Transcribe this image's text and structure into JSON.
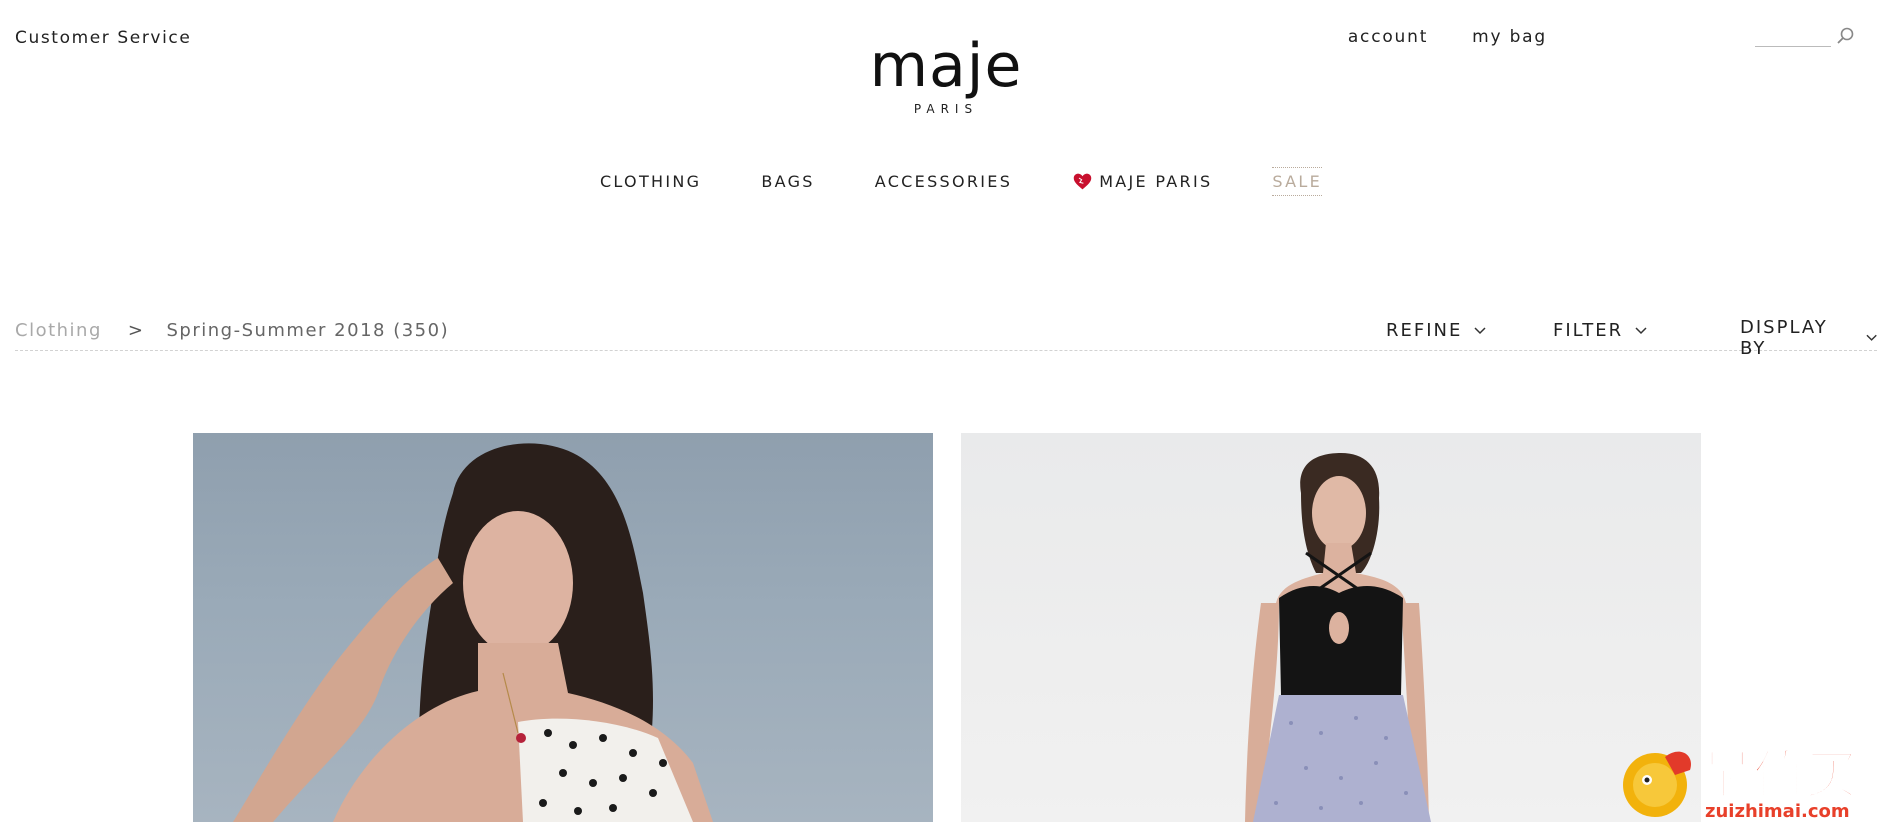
{
  "header": {
    "customer_service": "Customer Service",
    "logo_word": "maje",
    "logo_sub": "PARIS",
    "account": "account",
    "my_bag": "my bag",
    "search_placeholder": ""
  },
  "nav": {
    "items": [
      "CLOTHING",
      "BAGS",
      "ACCESSORIES",
      "MAJE PARIS"
    ],
    "sale": "SALE",
    "sale_color": "#b9ab9c"
  },
  "toolbar": {
    "crumb_root": "Clothing",
    "crumb_sep": ">",
    "crumb_current": "Spring-Summer 2018 (350)",
    "refine": "REFINE",
    "filter": "FILTER",
    "display_by": "DISPLAY BY"
  },
  "watermark": {
    "title": "最值买",
    "url": "zuizhimai.com"
  },
  "icons": {
    "search": "search-icon",
    "heart": "heart-icon",
    "chevron": "chevron-down-icon"
  }
}
